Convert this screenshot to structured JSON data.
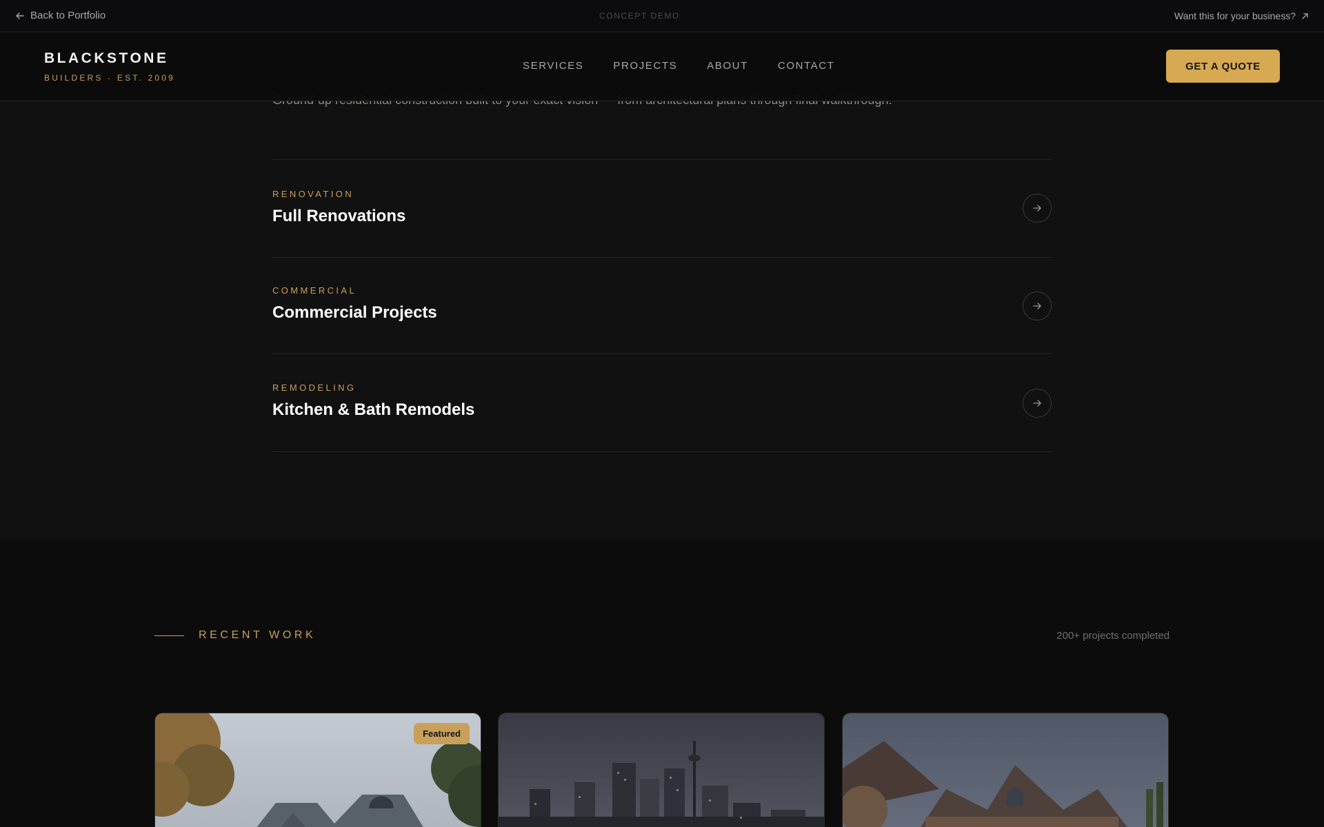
{
  "demo_bar": {
    "back_label": "Back to Portfolio",
    "concept_label": "CONCEPT DEMO",
    "cta_label": "Want this for your business?"
  },
  "header": {
    "brand_name": "BLACKSTONE",
    "brand_sub": "BUILDERS · EST. 2009",
    "nav": [
      "SERVICES",
      "PROJECTS",
      "ABOUT",
      "CONTACT"
    ],
    "quote_button": "GET A QUOTE"
  },
  "services": {
    "intro": "Ground-up residential construction built to your exact vision — from architectural plans through final walkthrough.",
    "items": [
      {
        "category": "RENOVATION",
        "title": "Full Renovations"
      },
      {
        "category": "COMMERCIAL",
        "title": "Commercial Projects"
      },
      {
        "category": "REMODELING",
        "title": "Kitchen & Bath Remodels"
      }
    ]
  },
  "recent_work": {
    "label": "RECENT WORK",
    "count": "200+ projects completed",
    "cards": [
      {
        "badge": "Featured"
      }
    ]
  },
  "colors": {
    "accent": "#c9a05a",
    "button": "#d6a952",
    "background": "#111111"
  }
}
